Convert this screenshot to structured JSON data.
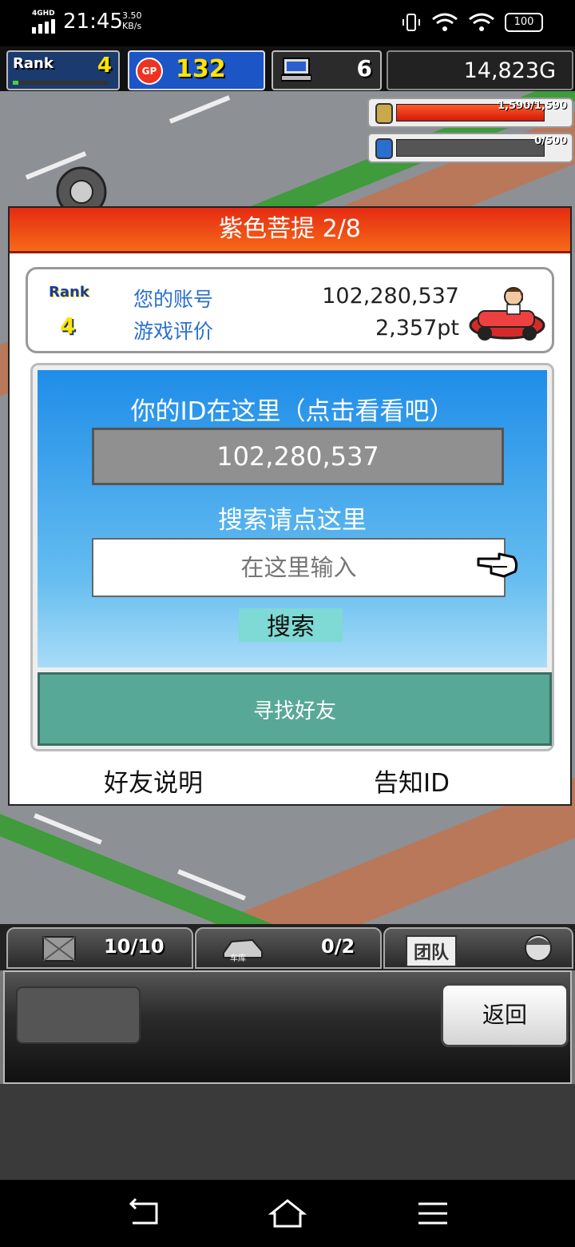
{
  "status_bar": {
    "network": "4GHD",
    "time": "21:45",
    "speed_value": "3.50",
    "speed_unit": "KB/s",
    "battery": "100"
  },
  "hud": {
    "rank_label": "Rank",
    "rank_value": "4",
    "gp_label": "GP",
    "gp_value": "132",
    "pc_value": "6",
    "money": "14,823G"
  },
  "meters": {
    "fuel": "1,590/1,590",
    "fuel_fraction": 1.0,
    "water": "0/500",
    "water_fraction": 0.0
  },
  "dialog": {
    "title": "紫色菩提 2/8",
    "card": {
      "rank_label": "Rank",
      "rank_value": "4",
      "account_label": "您的账号",
      "account_value": "102,280,537",
      "rating_label": "游戏评价",
      "rating_value": "2,357pt"
    },
    "id_hint": "你的ID在这里（点击看看吧）",
    "id_value": "102,280,537",
    "search_hint": "搜索请点这里",
    "search_placeholder": "在这里输入",
    "search_button": "搜索",
    "find_friend": "寻找好友",
    "friend_help": "好友说明",
    "share_id": "告知ID"
  },
  "bottom_bar": {
    "slot1": "10/10",
    "slot2_label": "车库",
    "slot2": "0/2",
    "slot3_label": "团队",
    "back_button": "返回"
  },
  "colors": {
    "title_red": "#e52a12",
    "panel_blue": "#1f8de8",
    "find_green": "#58a897",
    "gp_blue": "#1b55c6"
  }
}
